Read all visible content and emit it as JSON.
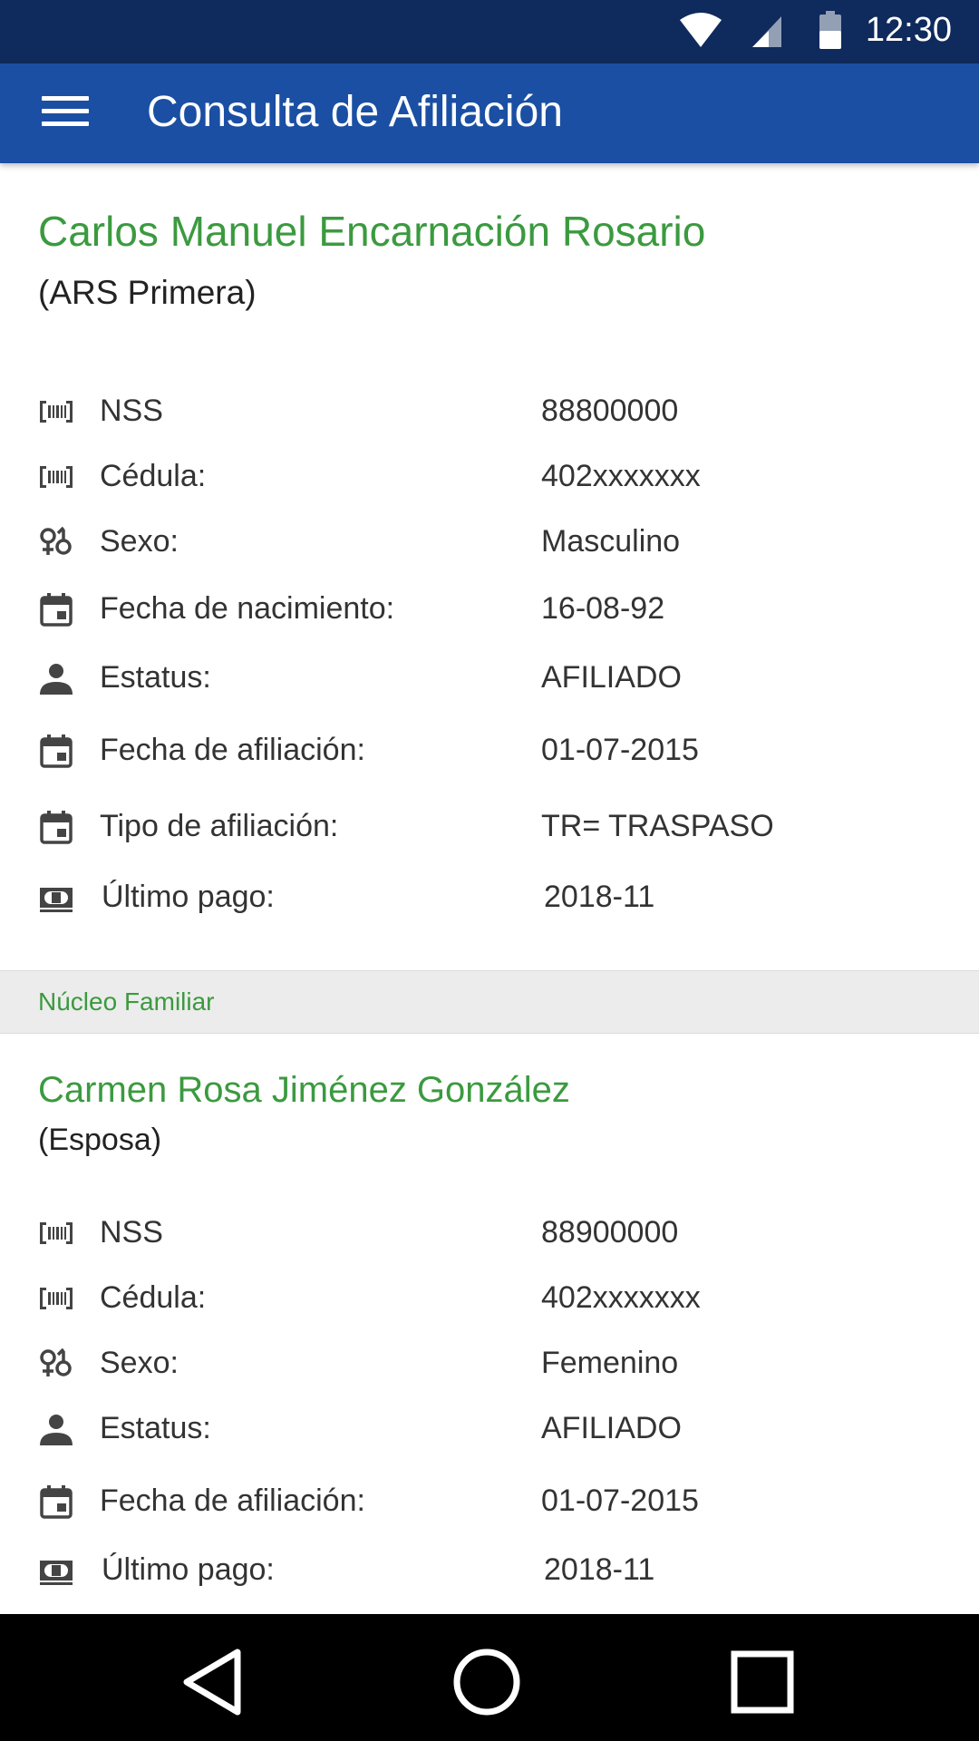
{
  "status_bar": {
    "time": "12:30",
    "icons": [
      "wifi-icon",
      "cell-signal-icon",
      "battery-icon"
    ]
  },
  "app_bar": {
    "title": "Consulta de Afiliación",
    "menu_icon": "menu-icon"
  },
  "colors": {
    "status_bar": "#0f2a5c",
    "app_bar": "#1a4fa3",
    "accent_green": "#3b9a3f",
    "section_bg": "#ececec",
    "icon_gray": "#444444",
    "nav_bar": "#000000"
  },
  "primary": {
    "name": "Carlos Manuel Encarnación Rosario",
    "subtitle": "(ARS Primera)",
    "fields": [
      {
        "icon": "barcode-icon",
        "label": "NSS",
        "value": "88800000"
      },
      {
        "icon": "barcode-icon",
        "label": "Cédula:",
        "value": "402xxxxxxx"
      },
      {
        "icon": "gender-icon",
        "label": "Sexo:",
        "value": "Masculino"
      },
      {
        "icon": "calendar-icon",
        "label": "Fecha de nacimiento:",
        "value": "16-08-92"
      },
      {
        "icon": "person-icon",
        "label": "Estatus:",
        "value": "AFILIADO"
      },
      {
        "icon": "calendar-icon",
        "label": "Fecha de afiliación:",
        "value": "01-07-2015"
      },
      {
        "icon": "calendar-icon",
        "label": "Tipo de afiliación:",
        "value": "TR= TRASPASO"
      },
      {
        "icon": "money-icon",
        "label": "Último pago:",
        "value": "2018-11"
      }
    ]
  },
  "section": {
    "title": "Núcleo Familiar"
  },
  "family": {
    "name": "Carmen Rosa Jiménez González",
    "subtitle": "(Esposa)",
    "fields": [
      {
        "icon": "barcode-icon",
        "label": "NSS",
        "value": "88900000"
      },
      {
        "icon": "barcode-icon",
        "label": "Cédula:",
        "value": "402xxxxxxx"
      },
      {
        "icon": "gender-icon",
        "label": "Sexo:",
        "value": "Femenino"
      },
      {
        "icon": "person-icon",
        "label": "Estatus:",
        "value": "AFILIADO"
      },
      {
        "icon": "calendar-icon",
        "label": "Fecha de afiliación:",
        "value": "01-07-2015"
      },
      {
        "icon": "money-icon",
        "label": "Último pago:",
        "value": "2018-11"
      }
    ]
  },
  "nav_bar": {
    "buttons": [
      "back-icon",
      "home-icon",
      "recents-icon"
    ]
  }
}
